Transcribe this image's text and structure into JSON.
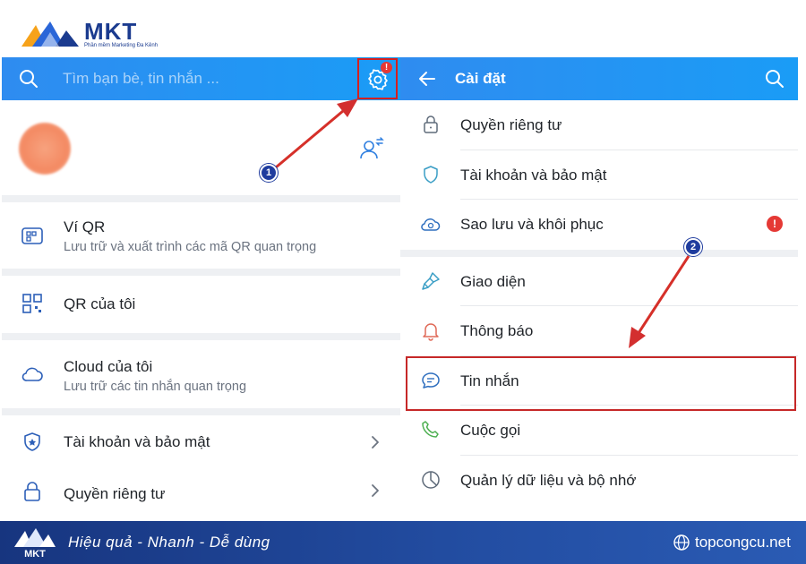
{
  "brand": {
    "logo_text": "MKT",
    "logo_sub": "Phần mềm Marketing Đa Kênh",
    "footer_tagline": "Hiệu quả - Nhanh  - Dễ dùng",
    "footer_site": "topcongcu.net"
  },
  "left": {
    "search_placeholder": "Tìm bạn bè, tin nhắn ...",
    "gear_badge": "!",
    "rows": [
      {
        "title": "Ví QR",
        "subtitle": "Lưu trữ và xuất trình các mã QR quan trọng"
      },
      {
        "title": "QR của tôi"
      },
      {
        "title": "Cloud của tôi",
        "subtitle": "Lưu trữ các tin nhắn quan trọng"
      },
      {
        "title": "Tài khoản và bảo mật"
      },
      {
        "title": "Quyền riêng tư"
      }
    ]
  },
  "right": {
    "title": "Cài đặt",
    "items": [
      {
        "label": "Quyền riêng tư"
      },
      {
        "label": "Tài khoản và bảo mật"
      },
      {
        "label": "Sao lưu và khôi phục",
        "badge": "!"
      },
      {
        "label": "Giao diện"
      },
      {
        "label": "Thông báo"
      },
      {
        "label": "Tin nhắn"
      },
      {
        "label": "Cuộc gọi"
      },
      {
        "label": "Quản lý dữ liệu và bộ nhớ"
      }
    ]
  },
  "steps": {
    "one": "1",
    "two": "2"
  },
  "colors": {
    "topbar": "#2f8cf0",
    "highlight": "#c62828",
    "step": "#1f3c9e",
    "footer": "#17357f"
  }
}
